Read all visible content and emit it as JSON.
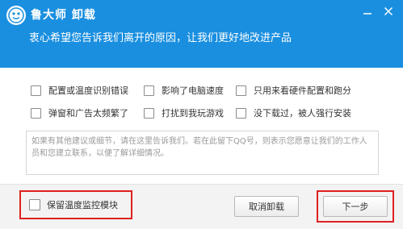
{
  "window": {
    "app_title": "鲁大师 卸载",
    "subtitle": "衷心希望您告诉我们离开的原因，让我们更好地改进产品",
    "min_icon": "minimize-icon",
    "close_icon": "close-icon",
    "logo_icon": "ludashi-logo",
    "accent_color": "#1a8fe0",
    "highlight_color": "#e02020"
  },
  "reasons": [
    {
      "label": "配置或温度识别错误",
      "checked": false
    },
    {
      "label": "影响了电脑速度",
      "checked": false
    },
    {
      "label": "只用来看硬件配置和跑分",
      "checked": false
    },
    {
      "label": "弹窗和广告太频繁了",
      "checked": false
    },
    {
      "label": "打扰到我玩游戏",
      "checked": false
    },
    {
      "label": "没下载过，被人强行安装",
      "checked": false
    }
  ],
  "feedback": {
    "placeholder": "如果有其他建议或细节，请在这里告诉我们。若在此留下QQ号，则表示您愿意让我们的工作人员和您建立联系，以便了解详细情况。"
  },
  "footer": {
    "keep_module_label": "保留温度监控模块",
    "keep_module_checked": false,
    "cancel_label": "取消卸载",
    "next_label": "下一步"
  }
}
